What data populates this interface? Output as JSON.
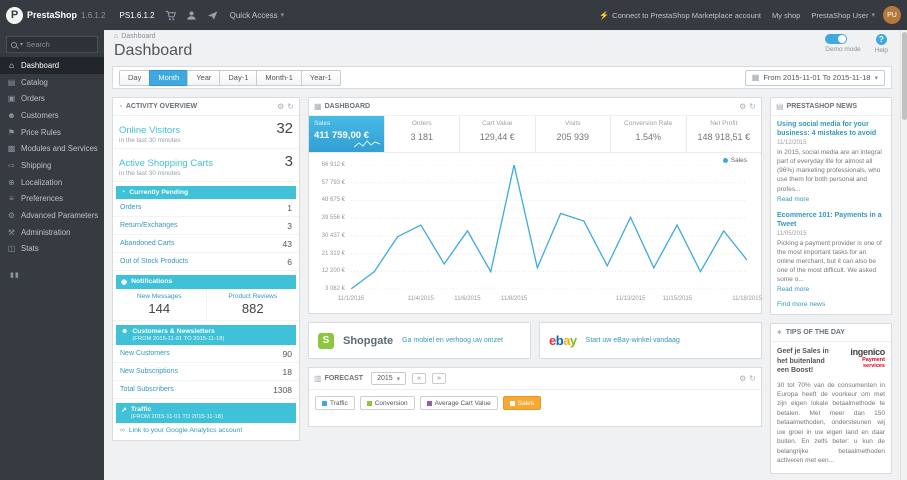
{
  "icons": {
    "caret_down": "▾",
    "home": "⌂",
    "gear": "⚙",
    "refresh": "↻",
    "calendar": "▦",
    "clock": "◔",
    "bell": "◉",
    "people": "☻",
    "trend": "↗",
    "plug": "⚡",
    "help": "?",
    "dashboard_panel": "▦",
    "forecast": "▥",
    "news": "▤",
    "tips": "✦",
    "collapse": "▮▮",
    "prev": "«",
    "next": "»",
    "link": "∞",
    "logo_letter": "P"
  },
  "topbar": {
    "brand": "PrestaShop",
    "version": "1.6.1.2",
    "shop_name": "PS1.6.1.2",
    "quick_access": "Quick Access",
    "marketplace": "Connect to PrestaShop Marketplace account",
    "my_shop": "My shop",
    "user": "PrestaShop User",
    "avatar_initials": "PU"
  },
  "sidebar": {
    "search_placeholder": "Search",
    "items": [
      {
        "label": "Dashboard",
        "icon": "⌂",
        "active": true
      },
      {
        "label": "Catalog",
        "icon": "▤"
      },
      {
        "label": "Orders",
        "icon": "▣"
      },
      {
        "label": "Customers",
        "icon": "☻"
      },
      {
        "label": "Price Rules",
        "icon": "⚑"
      },
      {
        "label": "Modules and Services",
        "icon": "▩"
      },
      {
        "label": "Shipping",
        "icon": "⇨"
      },
      {
        "label": "Localization",
        "icon": "⊕"
      },
      {
        "label": "Preferences",
        "icon": "≡"
      },
      {
        "label": "Advanced Parameters",
        "icon": "⚙"
      },
      {
        "label": "Administration",
        "icon": "⚒"
      },
      {
        "label": "Stats",
        "icon": "◫"
      }
    ]
  },
  "header": {
    "breadcrumb": "Dashboard",
    "title": "Dashboard",
    "demo_mode": "Demo mode",
    "help": "Help"
  },
  "filters": {
    "buttons": [
      "Day",
      "Month",
      "Year",
      "Day-1",
      "Month-1",
      "Year-1"
    ],
    "active": "Month",
    "date_range": "From 2015-11-01 To 2015-11-18"
  },
  "activity": {
    "title": "ACTIVITY OVERVIEW",
    "online_visitors_label": "Online Visitors",
    "online_visitors": "32",
    "online_visitors_sub": "in the last 30 minutes",
    "active_carts_label": "Active Shopping Carts",
    "active_carts": "3",
    "active_carts_sub": "in the last 30 minutes",
    "pending_title": "Currently Pending",
    "pending_rows": [
      {
        "label": "Orders",
        "value": "1"
      },
      {
        "label": "Return/Exchanges",
        "value": "3"
      },
      {
        "label": "Abandoned Carts",
        "value": "43"
      },
      {
        "label": "Out of Stock Products",
        "value": "6"
      }
    ],
    "notifications_title": "Notifications",
    "notifications": [
      {
        "label": "New Messages",
        "value": "144"
      },
      {
        "label": "Product Reviews",
        "value": "882"
      }
    ],
    "customers_title": "Customers & Newsletters",
    "customers_sub": "(FROM 2015-11-01 TO 2015-11-18)",
    "customers_rows": [
      {
        "label": "New Customers",
        "value": "90"
      },
      {
        "label": "New Subscriptions",
        "value": "18"
      },
      {
        "label": "Total Subscribers",
        "value": "1308"
      }
    ],
    "traffic_title": "Traffic",
    "traffic_sub": "(FROM 2015-11-01 TO 2015-11-18)",
    "traffic_link": "Link to your Google Analytics account"
  },
  "dashboard_panel": {
    "title": "DASHBOARD",
    "kpis": [
      {
        "label": "Sales",
        "value": "411 759,00 €",
        "active": true
      },
      {
        "label": "Orders",
        "value": "3 181"
      },
      {
        "label": "Cart Value",
        "value": "129,44 €"
      },
      {
        "label": "Visits",
        "value": "205 939"
      },
      {
        "label": "Conversion Rate",
        "value": "1.54%"
      },
      {
        "label": "Net Profit",
        "value": "148 918,51 €"
      }
    ],
    "legend": "Sales"
  },
  "chart_data": {
    "type": "line",
    "title": "Sales trend",
    "x_ticks": [
      {
        "label": "11/1/2015",
        "pos": 0
      },
      {
        "label": "11/4/2015",
        "pos": 0.176
      },
      {
        "label": "11/6/2015",
        "pos": 0.294
      },
      {
        "label": "11/8/2015",
        "pos": 0.412
      },
      {
        "label": "11/13/2015",
        "pos": 0.706
      },
      {
        "label": "11/15/2015",
        "pos": 0.824
      },
      {
        "label": "11/18/2015",
        "pos": 1
      }
    ],
    "y_ticks": [
      "66 912 €",
      "57 793 €",
      "48 675 €",
      "39 556 €",
      "30 437 €",
      "21 319 €",
      "12 200 €",
      "3 082 €"
    ],
    "ylim": [
      3082,
      66912
    ],
    "series": [
      {
        "name": "Sales",
        "color": "#3ea9de",
        "values": [
          3082,
          12000,
          30000,
          36000,
          16000,
          33000,
          12000,
          66912,
          14000,
          42000,
          38000,
          15000,
          40000,
          14000,
          36000,
          12000,
          33000,
          18000
        ]
      }
    ],
    "legend_position": "top-right",
    "grid": true
  },
  "modules": [
    {
      "name": "Shopgate",
      "badge": "S",
      "link": "Ga mobiel en verhoog uw omzet"
    },
    {
      "name": "ebay",
      "letters": [
        "e",
        "b",
        "a",
        "y"
      ],
      "link": "Start uw eBay-winkel vandaag"
    }
  ],
  "forecast": {
    "title": "FORECAST",
    "year": "2015",
    "legend": [
      {
        "label": "Traffic"
      },
      {
        "label": "Conversion"
      },
      {
        "label": "Average Cart Value"
      },
      {
        "label": "Sales",
        "active": true
      }
    ]
  },
  "news": {
    "title": "PRESTASHOP NEWS",
    "articles": [
      {
        "title": "Using social media for your business: 4 mistakes to avoid",
        "date": "11/12/2015",
        "body": "In 2015, social media are an integral part of everyday life for almost all (96%) marketing professionals, who use them for both personal and profes...",
        "read_more": "Read more"
      },
      {
        "title": "Ecommerce 101: Payments in a Tweet",
        "date": "11/05/2015",
        "body": "Picking a payment provider is one of the most important tasks for an online merchant, but it can also be one of the most difficult. We asked some o...",
        "read_more": "Read more"
      }
    ],
    "more": "Find more news"
  },
  "tips": {
    "title": "TIPS OF THE DAY",
    "heading": "Geef je Sales in het buitenland een Boost!",
    "brand": "ingenico",
    "brand_sub": "Payment services",
    "body": "30 tot 70% van de consumenten in Europa heeft de voorkeur om met zijn eigen lokale betaalmethode te betalen. Met meer dan 150 betaalmethoden, ondersteunen wij uw groei in uw eigen land en daar buiten. En zelfs beter: u kun de belangrijke betaalmethoden activeren met een..."
  }
}
